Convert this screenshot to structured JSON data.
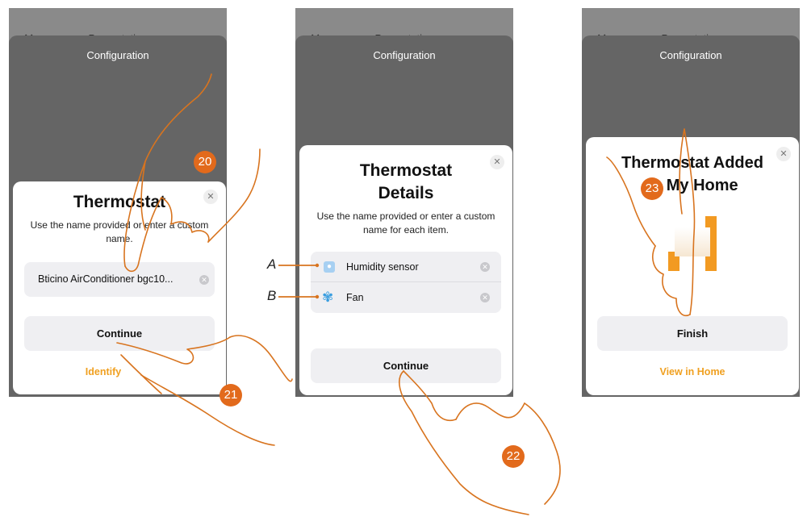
{
  "screens": [
    {
      "header_title": "Presentation",
      "sheet_title": "Configuration",
      "modal_title": "Thermostat",
      "modal_subtitle": "Use the name provided or enter a custom name.",
      "name_value": "Bticino AirConditioner bgc10...",
      "continue_label": "Continue",
      "identify_label": "Identify"
    },
    {
      "header_title": "Presentation",
      "sheet_title": "Configuration",
      "modal_title_line1": "Thermostat",
      "modal_title_line2": "Details",
      "modal_subtitle": "Use the name provided or enter a custom name for each item.",
      "items": [
        {
          "callout": "A",
          "label": "Humidity sensor",
          "icon": "droplet-icon"
        },
        {
          "callout": "B",
          "label": "Fan",
          "icon": "fan-icon"
        }
      ],
      "continue_label": "Continue"
    },
    {
      "header_title": "Presentation",
      "sheet_title": "Configuration",
      "modal_title_line1": "Thermostat Added",
      "modal_title_line2": "to My Home",
      "finish_label": "Finish",
      "view_label": "View in Home"
    }
  ],
  "steps": [
    "20",
    "21",
    "22",
    "23"
  ],
  "colors": {
    "accent": "#f0a020",
    "step_badge": "#e26a1c",
    "hand_stroke": "#d8741f"
  }
}
